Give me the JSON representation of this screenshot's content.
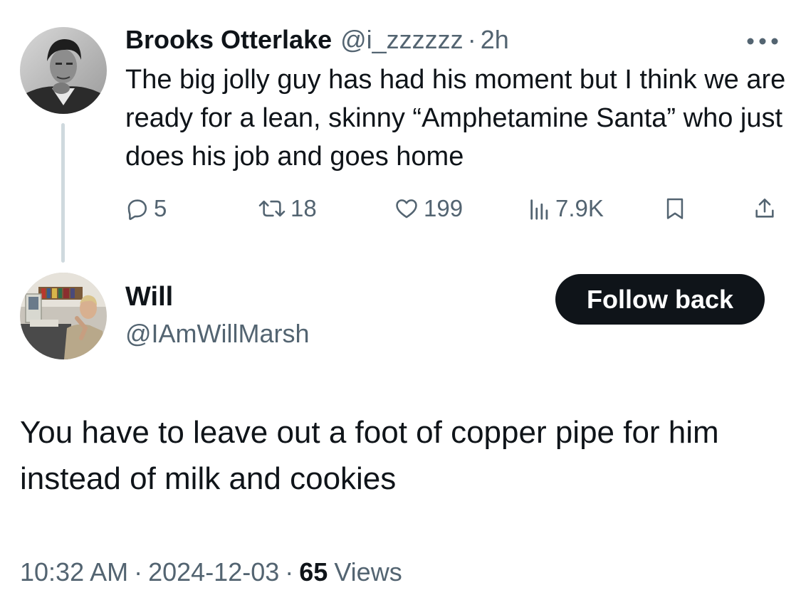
{
  "parent_tweet": {
    "author_name": "Brooks Otterlake",
    "author_handle": "@i_zzzzzz",
    "separator": "·",
    "time": "2h",
    "text": "The big jolly guy has had his moment but I think we are ready for a lean, skinny “Amphetamine Santa” who just does his job and goes home",
    "actions": {
      "replies": "5",
      "reposts": "18",
      "likes": "199",
      "views": "7.9K"
    },
    "icons": [
      "more-icon",
      "reply-icon",
      "repost-icon",
      "like-icon",
      "views-icon",
      "bookmark-icon",
      "share-icon"
    ]
  },
  "reply_tweet": {
    "author_name": "Will",
    "author_handle": "@IAmWillMarsh",
    "follow_button_label": "Follow back",
    "text": "You have to leave out a foot of copper pipe for him instead of milk and cookies",
    "timestamp_time": "10:32 AM",
    "timestamp_date": "2024-12-03",
    "separator": "·",
    "views_count": "65",
    "views_label": "Views"
  },
  "colors": {
    "text_primary": "#0f1419",
    "text_secondary": "#536471",
    "thread_line": "#cfd9de",
    "button_background": "#0f1419",
    "button_text": "#ffffff",
    "background": "#ffffff"
  }
}
